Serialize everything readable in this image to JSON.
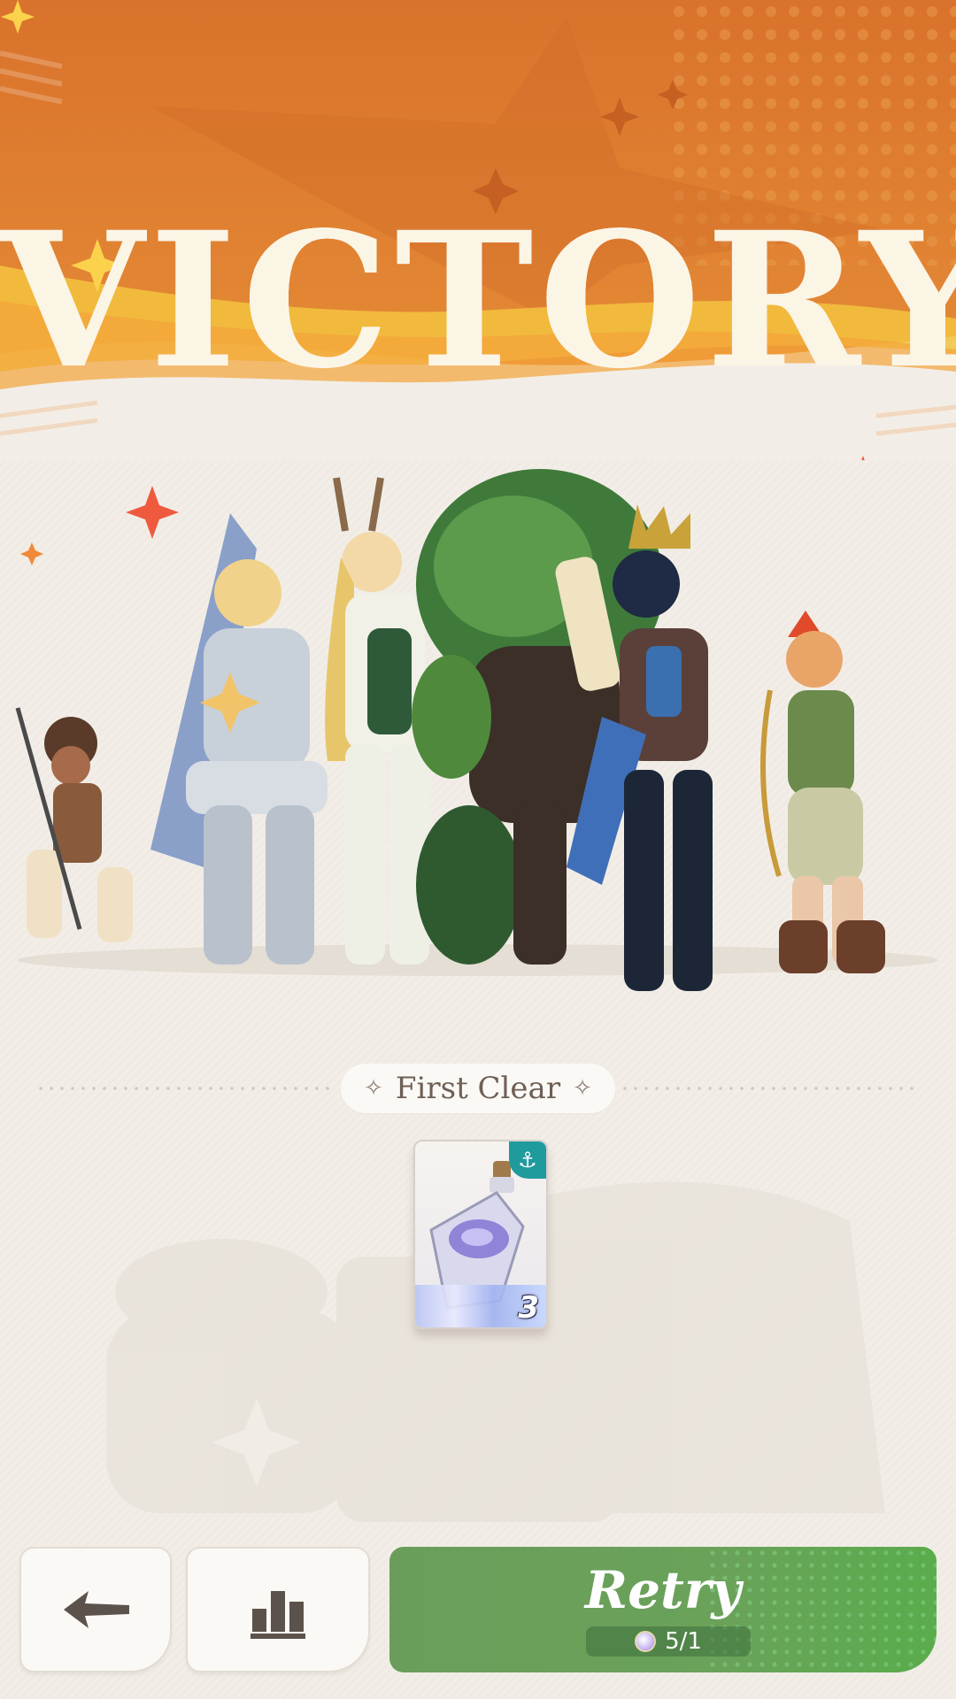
{
  "banner": {
    "title": "VICTORY"
  },
  "heroes": {
    "count": 6
  },
  "rewards": {
    "section_label": "First Clear",
    "items": [
      {
        "icon": "potion-icon",
        "badge_icon": "anchor-icon",
        "quantity": "3"
      }
    ]
  },
  "bottom_bar": {
    "back_icon": "back-arrow-icon",
    "stats_icon": "bar-chart-icon",
    "retry_label": "Retry",
    "stamina_text": "5/1"
  },
  "colors": {
    "banner_orange": "#e3822f",
    "banner_yellow": "#f3c33f",
    "retry_green": "#6a9d5a",
    "anchor_teal": "#1f9a9d",
    "background": "#f2eee7"
  }
}
